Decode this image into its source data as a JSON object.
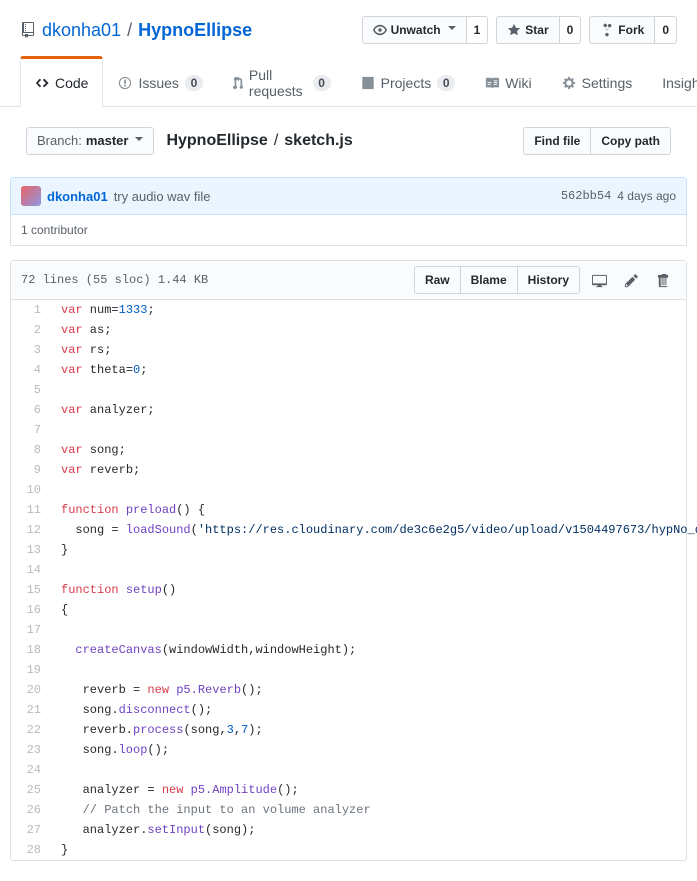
{
  "repo": {
    "owner": "dkonha01",
    "name": "HypnoEllipse"
  },
  "headerActions": {
    "watch": {
      "label": "Unwatch",
      "count": "1"
    },
    "star": {
      "label": "Star",
      "count": "0"
    },
    "fork": {
      "label": "Fork",
      "count": "0"
    }
  },
  "tabs": {
    "code": "Code",
    "issues": {
      "label": "Issues",
      "count": "0"
    },
    "pulls": {
      "label": "Pull requests",
      "count": "0"
    },
    "projects": {
      "label": "Projects",
      "count": "0"
    },
    "wiki": "Wiki",
    "settings": "Settings",
    "insights": "Insights"
  },
  "branch": {
    "label": "Branch:",
    "name": "master"
  },
  "breadcrumb": {
    "root": "HypnoEllipse",
    "file": "sketch.js"
  },
  "subheadActions": {
    "find": "Find file",
    "copy": "Copy path"
  },
  "commit": {
    "author": "dkonha01",
    "message": "try audio wav file",
    "sha": "562bb54",
    "date": "4 days ago"
  },
  "contributors": "1 contributor",
  "fileMeta": "72 lines (55 sloc)  1.44 KB",
  "fileActions": {
    "raw": "Raw",
    "blame": "Blame",
    "history": "History"
  },
  "code": [
    {
      "n": 1,
      "h": "<span class='k'>var</span> num=<span class='n'>1333</span>;"
    },
    {
      "n": 2,
      "h": "<span class='k'>var</span> as;"
    },
    {
      "n": 3,
      "h": "<span class='k'>var</span> rs;"
    },
    {
      "n": 4,
      "h": "<span class='k'>var</span> theta=<span class='n'>0</span>;"
    },
    {
      "n": 5,
      "h": ""
    },
    {
      "n": 6,
      "h": "<span class='k'>var</span> analyzer;"
    },
    {
      "n": 7,
      "h": ""
    },
    {
      "n": 8,
      "h": "<span class='k'>var</span> song;"
    },
    {
      "n": 9,
      "h": "<span class='k'>var</span> reverb;"
    },
    {
      "n": 10,
      "h": ""
    },
    {
      "n": 11,
      "h": "<span class='k'>function</span> <span class='f'>preload</span>() {"
    },
    {
      "n": 12,
      "h": "  song = <span class='f'>loadSound</span>(<span class='s'>'https://res.cloudinary.com/de3c6e2g5/video/upload/v1504497673/hypNo_qpbdwj.wav'</span>);"
    },
    {
      "n": 13,
      "h": "}"
    },
    {
      "n": 14,
      "h": ""
    },
    {
      "n": 15,
      "h": "<span class='k'>function</span> <span class='f'>setup</span>()"
    },
    {
      "n": 16,
      "h": "{"
    },
    {
      "n": 17,
      "h": ""
    },
    {
      "n": 18,
      "h": "  <span class='f'>createCanvas</span>(windowWidth,windowHeight);"
    },
    {
      "n": 19,
      "h": ""
    },
    {
      "n": 20,
      "h": "   reverb = <span class='k'>new</span> <span class='f'>p5.Reverb</span>();"
    },
    {
      "n": 21,
      "h": "   song.<span class='f'>disconnect</span>();"
    },
    {
      "n": 22,
      "h": "   reverb.<span class='f'>process</span>(song,<span class='n'>3</span>,<span class='n'>7</span>);"
    },
    {
      "n": 23,
      "h": "   song.<span class='f'>loop</span>();"
    },
    {
      "n": 24,
      "h": ""
    },
    {
      "n": 25,
      "h": "   analyzer = <span class='k'>new</span> <span class='f'>p5.Amplitude</span>();"
    },
    {
      "n": 26,
      "h": "   <span class='c'>// Patch the input to an volume analyzer</span>"
    },
    {
      "n": 27,
      "h": "   analyzer.<span class='f'>setInput</span>(song);"
    },
    {
      "n": 28,
      "h": "}"
    }
  ]
}
